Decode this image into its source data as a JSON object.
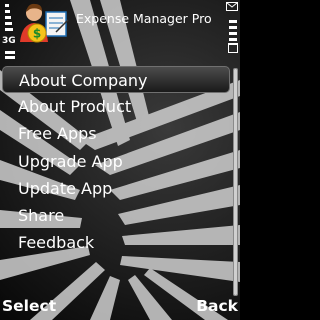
{
  "status": {
    "network": "3G",
    "signal_level": 0.85,
    "battery_level": 0.85
  },
  "app": {
    "title": "Expense Manager Pro",
    "icon": "user-money-icon"
  },
  "menu": {
    "selected_index": 0,
    "items": [
      {
        "label": "About Company"
      },
      {
        "label": "About Product"
      },
      {
        "label": "Free Apps"
      },
      {
        "label": "Upgrade App"
      },
      {
        "label": "Update App"
      },
      {
        "label": "Share"
      },
      {
        "label": "Feedback"
      }
    ]
  },
  "softkeys": {
    "left": "Select",
    "right": "Back"
  },
  "colors": {
    "text": "#ffffff",
    "highlight": "#3a3a3a",
    "background": "#111111"
  }
}
